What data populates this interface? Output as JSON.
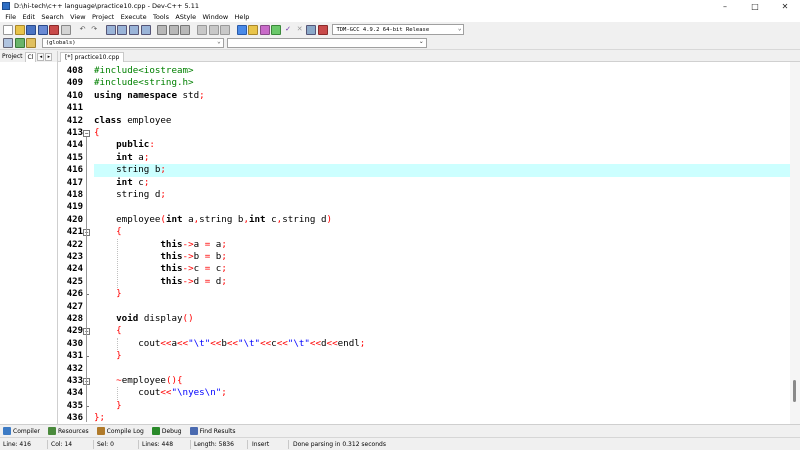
{
  "window": {
    "title": "D:\\hi-tech\\c++ language\\practice10.cpp - Dev-C++ 5.11",
    "minimize_glyph": "–",
    "maximize_glyph": "□",
    "close_glyph": "✕"
  },
  "menu": [
    "File",
    "Edit",
    "Search",
    "View",
    "Project",
    "Execute",
    "Tools",
    "AStyle",
    "Window",
    "Help"
  ],
  "toolbar": {
    "compiler": "TDM-GCC 4.9.2 64-bit Release",
    "chevron": "⌄",
    "globals": "(globals)"
  },
  "left_panel": {
    "tab_project": "Project",
    "tab_classes": "Cl",
    "arrow_left": "◂",
    "arrow_right": "▸"
  },
  "editor": {
    "tab_label": "[*] practice10.cpp",
    "lines": [
      {
        "num": "408",
        "tokens": [
          {
            "t": "#include<iostream>",
            "c": "pre"
          }
        ]
      },
      {
        "num": "409",
        "tokens": [
          {
            "t": "#include<string.h>",
            "c": "pre"
          }
        ]
      },
      {
        "num": "410",
        "tokens": [
          {
            "t": "using namespace ",
            "c": "kw"
          },
          {
            "t": "std",
            "c": "plain"
          },
          {
            "t": ";",
            "c": "sym"
          }
        ]
      },
      {
        "num": "411",
        "tokens": []
      },
      {
        "num": "412",
        "tokens": [
          {
            "t": "class ",
            "c": "kw"
          },
          {
            "t": "employee",
            "c": "plain"
          }
        ]
      },
      {
        "num": "413",
        "fold": "open",
        "tokens": [
          {
            "t": "{",
            "c": "sym"
          }
        ]
      },
      {
        "num": "414",
        "tokens": [
          {
            "t": "    ",
            "c": "plain"
          },
          {
            "t": "public",
            "c": "kw"
          },
          {
            "t": ":",
            "c": "sym"
          }
        ]
      },
      {
        "num": "415",
        "tokens": [
          {
            "t": "    ",
            "c": "plain"
          },
          {
            "t": "int ",
            "c": "kw"
          },
          {
            "t": "a",
            "c": "plain"
          },
          {
            "t": ";",
            "c": "sym"
          }
        ]
      },
      {
        "num": "416",
        "highlight": true,
        "tokens": [
          {
            "t": "    string b",
            "c": "plain"
          },
          {
            "t": ";",
            "c": "sym"
          }
        ]
      },
      {
        "num": "417",
        "tokens": [
          {
            "t": "    ",
            "c": "plain"
          },
          {
            "t": "int ",
            "c": "kw"
          },
          {
            "t": "c",
            "c": "plain"
          },
          {
            "t": ";",
            "c": "sym"
          }
        ]
      },
      {
        "num": "418",
        "tokens": [
          {
            "t": "    string d",
            "c": "plain"
          },
          {
            "t": ";",
            "c": "sym"
          }
        ]
      },
      {
        "num": "419",
        "tokens": []
      },
      {
        "num": "420",
        "tokens": [
          {
            "t": "    employee",
            "c": "plain"
          },
          {
            "t": "(",
            "c": "sym"
          },
          {
            "t": "int ",
            "c": "kw"
          },
          {
            "t": "a",
            "c": "plain"
          },
          {
            "t": ",",
            "c": "sym"
          },
          {
            "t": "string b",
            "c": "plain"
          },
          {
            "t": ",",
            "c": "sym"
          },
          {
            "t": "int ",
            "c": "kw"
          },
          {
            "t": "c",
            "c": "plain"
          },
          {
            "t": ",",
            "c": "sym"
          },
          {
            "t": "string d",
            "c": "plain"
          },
          {
            "t": ")",
            "c": "sym"
          }
        ]
      },
      {
        "num": "421",
        "fold": "open",
        "tokens": [
          {
            "t": "    ",
            "c": "plain"
          },
          {
            "t": "{",
            "c": "sym"
          }
        ]
      },
      {
        "num": "422",
        "tokens": [
          {
            "t": "            ",
            "c": "plain"
          },
          {
            "t": "this",
            "c": "kw"
          },
          {
            "t": "->",
            "c": "sym"
          },
          {
            "t": "a ",
            "c": "plain"
          },
          {
            "t": "=",
            "c": "sym"
          },
          {
            "t": " a",
            "c": "plain"
          },
          {
            "t": ";",
            "c": "sym"
          }
        ]
      },
      {
        "num": "423",
        "tokens": [
          {
            "t": "            ",
            "c": "plain"
          },
          {
            "t": "this",
            "c": "kw"
          },
          {
            "t": "->",
            "c": "sym"
          },
          {
            "t": "b ",
            "c": "plain"
          },
          {
            "t": "=",
            "c": "sym"
          },
          {
            "t": " b",
            "c": "plain"
          },
          {
            "t": ";",
            "c": "sym"
          }
        ]
      },
      {
        "num": "424",
        "tokens": [
          {
            "t": "            ",
            "c": "plain"
          },
          {
            "t": "this",
            "c": "kw"
          },
          {
            "t": "->",
            "c": "sym"
          },
          {
            "t": "c ",
            "c": "plain"
          },
          {
            "t": "=",
            "c": "sym"
          },
          {
            "t": " c",
            "c": "plain"
          },
          {
            "t": ";",
            "c": "sym"
          }
        ]
      },
      {
        "num": "425",
        "tokens": [
          {
            "t": "            ",
            "c": "plain"
          },
          {
            "t": "this",
            "c": "kw"
          },
          {
            "t": "->",
            "c": "sym"
          },
          {
            "t": "d ",
            "c": "plain"
          },
          {
            "t": "=",
            "c": "sym"
          },
          {
            "t": " d",
            "c": "plain"
          },
          {
            "t": ";",
            "c": "sym"
          }
        ]
      },
      {
        "num": "426",
        "fold": "end",
        "tokens": [
          {
            "t": "    ",
            "c": "plain"
          },
          {
            "t": "}",
            "c": "sym"
          }
        ]
      },
      {
        "num": "427",
        "tokens": []
      },
      {
        "num": "428",
        "tokens": [
          {
            "t": "    ",
            "c": "plain"
          },
          {
            "t": "void ",
            "c": "kw"
          },
          {
            "t": "display",
            "c": "plain"
          },
          {
            "t": "()",
            "c": "sym"
          }
        ]
      },
      {
        "num": "429",
        "fold": "open",
        "tokens": [
          {
            "t": "    ",
            "c": "plain"
          },
          {
            "t": "{",
            "c": "sym"
          }
        ]
      },
      {
        "num": "430",
        "tokens": [
          {
            "t": "        cout",
            "c": "plain"
          },
          {
            "t": "<<",
            "c": "sym"
          },
          {
            "t": "a",
            "c": "plain"
          },
          {
            "t": "<<",
            "c": "sym"
          },
          {
            "t": "\"\\t\"",
            "c": "str"
          },
          {
            "t": "<<",
            "c": "sym"
          },
          {
            "t": "b",
            "c": "plain"
          },
          {
            "t": "<<",
            "c": "sym"
          },
          {
            "t": "\"\\t\"",
            "c": "str"
          },
          {
            "t": "<<",
            "c": "sym"
          },
          {
            "t": "c",
            "c": "plain"
          },
          {
            "t": "<<",
            "c": "sym"
          },
          {
            "t": "\"\\t\"",
            "c": "str"
          },
          {
            "t": "<<",
            "c": "sym"
          },
          {
            "t": "d",
            "c": "plain"
          },
          {
            "t": "<<",
            "c": "sym"
          },
          {
            "t": "endl",
            "c": "plain"
          },
          {
            "t": ";",
            "c": "sym"
          }
        ]
      },
      {
        "num": "431",
        "fold": "end",
        "tokens": [
          {
            "t": "    ",
            "c": "plain"
          },
          {
            "t": "}",
            "c": "sym"
          }
        ]
      },
      {
        "num": "432",
        "tokens": []
      },
      {
        "num": "433",
        "fold": "open",
        "tokens": [
          {
            "t": "    ",
            "c": "plain"
          },
          {
            "t": "~",
            "c": "sym"
          },
          {
            "t": "employee",
            "c": "plain"
          },
          {
            "t": "(){",
            "c": "sym"
          }
        ]
      },
      {
        "num": "434",
        "tokens": [
          {
            "t": "        cout",
            "c": "plain"
          },
          {
            "t": "<<",
            "c": "sym"
          },
          {
            "t": "\"\\nyes\\n\"",
            "c": "str"
          },
          {
            "t": ";",
            "c": "sym"
          }
        ]
      },
      {
        "num": "435",
        "fold": "end",
        "tokens": [
          {
            "t": "    ",
            "c": "plain"
          },
          {
            "t": "}",
            "c": "sym"
          }
        ]
      },
      {
        "num": "436",
        "tokens": [
          {
            "t": "}",
            "c": "sym"
          },
          {
            "t": ";",
            "c": "sym"
          }
        ]
      }
    ]
  },
  "bottom_tabs": [
    {
      "label": "Compiler",
      "icon": "compiler-icon",
      "color": "#3c7ac4"
    },
    {
      "label": "Resources",
      "icon": "resources-icon",
      "color": "#4a8a3c"
    },
    {
      "label": "Compile Log",
      "icon": "compile-log-icon",
      "color": "#b07a2a"
    },
    {
      "label": "Debug",
      "icon": "debug-icon",
      "color": "#2a8a2a"
    },
    {
      "label": "Find Results",
      "icon": "find-results-icon",
      "color": "#4a6ab0"
    }
  ],
  "status": {
    "line": "Line:   416",
    "col": "Col:    14",
    "sel": "Sel:    0",
    "lines": "Lines:   448",
    "length": "Length:   5836",
    "mode": "Insert",
    "message": "Done parsing in 0.312 seconds"
  }
}
